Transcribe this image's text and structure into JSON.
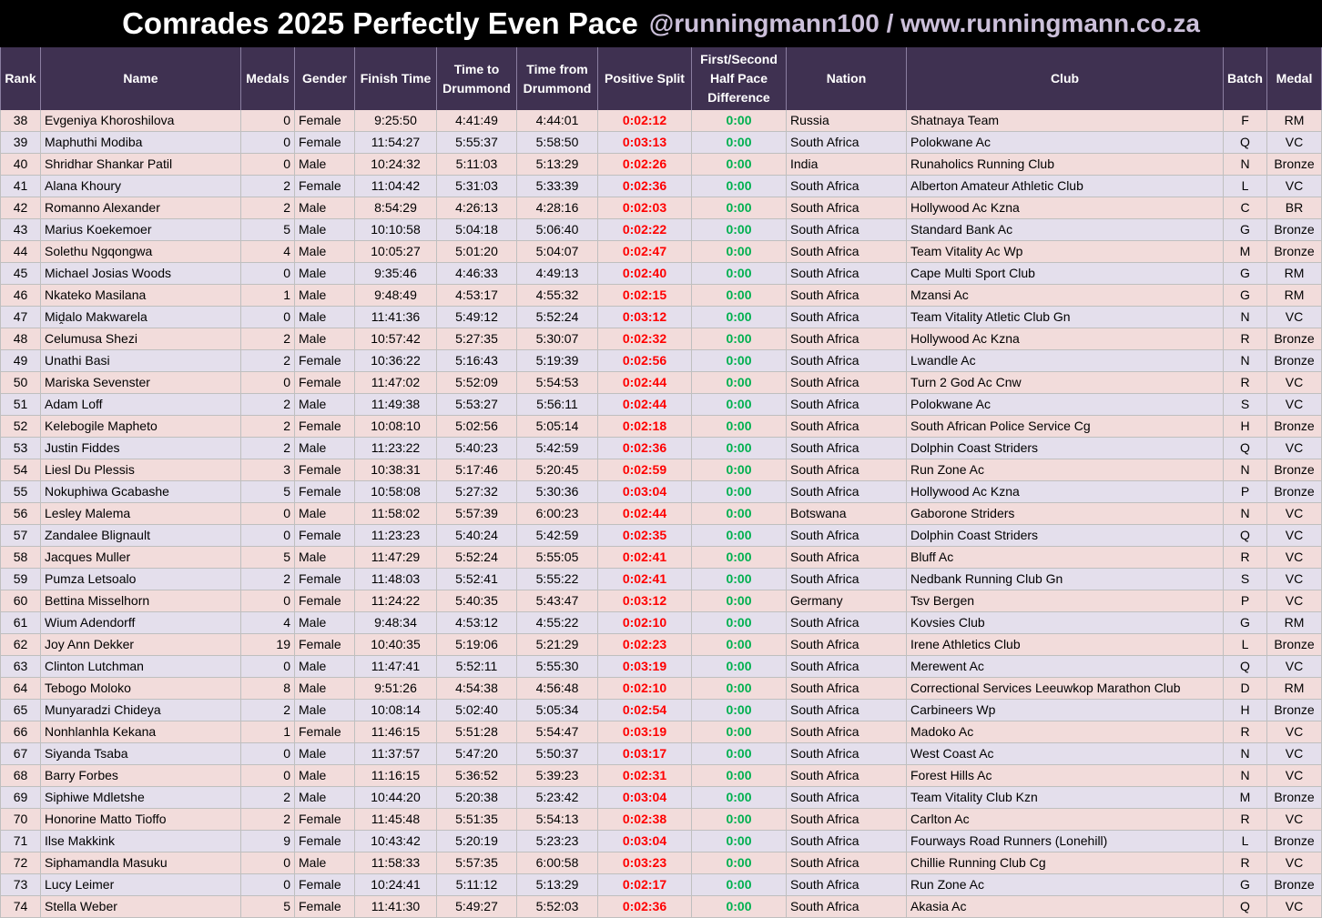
{
  "title": "Comrades 2025 Perfectly Even Pace",
  "subtitle": "@runningmann100 / www.runningmann.co.za",
  "colors": {
    "title_bar": "#000000",
    "subtitle": "#ccc0da",
    "header_bg": "#3f3151",
    "row_pink": "#f2dcdb",
    "row_lavender": "#e4dfec",
    "split_red": "#ff0000",
    "diff_green": "#00b050"
  },
  "columns": [
    "Rank",
    "Name",
    "Medals",
    "Gender",
    "Finish Time",
    "Time to\nDrummond",
    "Time from\nDrummond",
    "Positive Split",
    "First/Second\nHalf Pace\nDifference",
    "Nation",
    "Club",
    "Batch",
    "Medal"
  ],
  "rows": [
    [
      38,
      "Evgeniya Khoroshilova",
      0,
      "Female",
      "9:25:50",
      "4:41:49",
      "4:44:01",
      "0:02:12",
      "0:00",
      "Russia",
      "Shatnaya Team",
      "F",
      "RM"
    ],
    [
      39,
      "Maphuthi Modiba",
      0,
      "Female",
      "11:54:27",
      "5:55:37",
      "5:58:50",
      "0:03:13",
      "0:00",
      "South Africa",
      "Polokwane Ac",
      "Q",
      "VC"
    ],
    [
      40,
      "Shridhar Shankar Patil",
      0,
      "Male",
      "10:24:32",
      "5:11:03",
      "5:13:29",
      "0:02:26",
      "0:00",
      "India",
      "Runaholics Running Club",
      "N",
      "Bronze"
    ],
    [
      41,
      "Alana Khoury",
      2,
      "Female",
      "11:04:42",
      "5:31:03",
      "5:33:39",
      "0:02:36",
      "0:00",
      "South Africa",
      "Alberton Amateur Athletic Club",
      "L",
      "VC"
    ],
    [
      42,
      "Romanno Alexander",
      2,
      "Male",
      "8:54:29",
      "4:26:13",
      "4:28:16",
      "0:02:03",
      "0:00",
      "South Africa",
      "Hollywood Ac Kzna",
      "C",
      "BR"
    ],
    [
      43,
      "Marius Koekemoer",
      5,
      "Male",
      "10:10:58",
      "5:04:18",
      "5:06:40",
      "0:02:22",
      "0:00",
      "South Africa",
      "Standard Bank Ac",
      "G",
      "Bronze"
    ],
    [
      44,
      "Solethu Ngqongwa",
      4,
      "Male",
      "10:05:27",
      "5:01:20",
      "5:04:07",
      "0:02:47",
      "0:00",
      "South Africa",
      "Team Vitality Ac Wp",
      "M",
      "Bronze"
    ],
    [
      45,
      "Michael Josias Woods",
      0,
      "Male",
      "9:35:46",
      "4:46:33",
      "4:49:13",
      "0:02:40",
      "0:00",
      "South Africa",
      "Cape Multi Sport Club",
      "G",
      "RM"
    ],
    [
      46,
      "Nkateko Masilana",
      1,
      "Male",
      "9:48:49",
      "4:53:17",
      "4:55:32",
      "0:02:15",
      "0:00",
      "South Africa",
      "Mzansi Ac",
      "G",
      "RM"
    ],
    [
      47,
      "Miḓalo Makwarela",
      0,
      "Male",
      "11:41:36",
      "5:49:12",
      "5:52:24",
      "0:03:12",
      "0:00",
      "South Africa",
      "Team Vitality Atletic Club Gn",
      "N",
      "VC"
    ],
    [
      48,
      "Celumusa Shezi",
      2,
      "Male",
      "10:57:42",
      "5:27:35",
      "5:30:07",
      "0:02:32",
      "0:00",
      "South Africa",
      "Hollywood Ac Kzna",
      "R",
      "Bronze"
    ],
    [
      49,
      "Unathi Basi",
      2,
      "Female",
      "10:36:22",
      "5:16:43",
      "5:19:39",
      "0:02:56",
      "0:00",
      "South Africa",
      "Lwandle Ac",
      "N",
      "Bronze"
    ],
    [
      50,
      "Mariska Sevenster",
      0,
      "Female",
      "11:47:02",
      "5:52:09",
      "5:54:53",
      "0:02:44",
      "0:00",
      "South Africa",
      "Turn 2 God Ac Cnw",
      "R",
      "VC"
    ],
    [
      51,
      "Adam Loff",
      2,
      "Male",
      "11:49:38",
      "5:53:27",
      "5:56:11",
      "0:02:44",
      "0:00",
      "South Africa",
      "Polokwane Ac",
      "S",
      "VC"
    ],
    [
      52,
      "Kelebogile Mapheto",
      2,
      "Female",
      "10:08:10",
      "5:02:56",
      "5:05:14",
      "0:02:18",
      "0:00",
      "South Africa",
      "South African Police Service Cg",
      "H",
      "Bronze"
    ],
    [
      53,
      "Justin Fiddes",
      2,
      "Male",
      "11:23:22",
      "5:40:23",
      "5:42:59",
      "0:02:36",
      "0:00",
      "South Africa",
      "Dolphin Coast Striders",
      "Q",
      "VC"
    ],
    [
      54,
      "Liesl Du Plessis",
      3,
      "Female",
      "10:38:31",
      "5:17:46",
      "5:20:45",
      "0:02:59",
      "0:00",
      "South Africa",
      "Run Zone Ac",
      "N",
      "Bronze"
    ],
    [
      55,
      "Nokuphiwa Gcabashe",
      5,
      "Female",
      "10:58:08",
      "5:27:32",
      "5:30:36",
      "0:03:04",
      "0:00",
      "South Africa",
      "Hollywood Ac Kzna",
      "P",
      "Bronze"
    ],
    [
      56,
      "Lesley Malema",
      0,
      "Male",
      "11:58:02",
      "5:57:39",
      "6:00:23",
      "0:02:44",
      "0:00",
      "Botswana",
      "Gaborone Striders",
      "N",
      "VC"
    ],
    [
      57,
      "Zandalee Blignault",
      0,
      "Female",
      "11:23:23",
      "5:40:24",
      "5:42:59",
      "0:02:35",
      "0:00",
      "South Africa",
      "Dolphin Coast Striders",
      "Q",
      "VC"
    ],
    [
      58,
      "Jacques Muller",
      5,
      "Male",
      "11:47:29",
      "5:52:24",
      "5:55:05",
      "0:02:41",
      "0:00",
      "South Africa",
      "Bluff Ac",
      "R",
      "VC"
    ],
    [
      59,
      "Pumza Letsoalo",
      2,
      "Female",
      "11:48:03",
      "5:52:41",
      "5:55:22",
      "0:02:41",
      "0:00",
      "South Africa",
      "Nedbank Running Club Gn",
      "S",
      "VC"
    ],
    [
      60,
      "Bettina Misselhorn",
      0,
      "Female",
      "11:24:22",
      "5:40:35",
      "5:43:47",
      "0:03:12",
      "0:00",
      "Germany",
      "Tsv Bergen",
      "P",
      "VC"
    ],
    [
      61,
      "Wium Adendorff",
      4,
      "Male",
      "9:48:34",
      "4:53:12",
      "4:55:22",
      "0:02:10",
      "0:00",
      "South Africa",
      "Kovsies Club",
      "G",
      "RM"
    ],
    [
      62,
      "Joy Ann Dekker",
      19,
      "Female",
      "10:40:35",
      "5:19:06",
      "5:21:29",
      "0:02:23",
      "0:00",
      "South Africa",
      "Irene Athletics Club",
      "L",
      "Bronze"
    ],
    [
      63,
      "Clinton Lutchman",
      0,
      "Male",
      "11:47:41",
      "5:52:11",
      "5:55:30",
      "0:03:19",
      "0:00",
      "South Africa",
      "Merewent Ac",
      "Q",
      "VC"
    ],
    [
      64,
      "Tebogo Moloko",
      8,
      "Male",
      "9:51:26",
      "4:54:38",
      "4:56:48",
      "0:02:10",
      "0:00",
      "South Africa",
      "Correctional Services Leeuwkop Marathon Club",
      "D",
      "RM"
    ],
    [
      65,
      "Munyaradzi Chideya",
      2,
      "Male",
      "10:08:14",
      "5:02:40",
      "5:05:34",
      "0:02:54",
      "0:00",
      "South Africa",
      "Carbineers Wp",
      "H",
      "Bronze"
    ],
    [
      66,
      "Nonhlanhla Kekana",
      1,
      "Female",
      "11:46:15",
      "5:51:28",
      "5:54:47",
      "0:03:19",
      "0:00",
      "South Africa",
      "Madoko Ac",
      "R",
      "VC"
    ],
    [
      67,
      "Siyanda Tsaba",
      0,
      "Male",
      "11:37:57",
      "5:47:20",
      "5:50:37",
      "0:03:17",
      "0:00",
      "South Africa",
      "West Coast Ac",
      "N",
      "VC"
    ],
    [
      68,
      "Barry Forbes",
      0,
      "Male",
      "11:16:15",
      "5:36:52",
      "5:39:23",
      "0:02:31",
      "0:00",
      "South Africa",
      "Forest Hills Ac",
      "N",
      "VC"
    ],
    [
      69,
      "Siphiwe Mdletshe",
      2,
      "Male",
      "10:44:20",
      "5:20:38",
      "5:23:42",
      "0:03:04",
      "0:00",
      "South Africa",
      "Team Vitality Club Kzn",
      "M",
      "Bronze"
    ],
    [
      70,
      "Honorine Matto Tioffo",
      2,
      "Female",
      "11:45:48",
      "5:51:35",
      "5:54:13",
      "0:02:38",
      "0:00",
      "South Africa",
      "Carlton Ac",
      "R",
      "VC"
    ],
    [
      71,
      "Ilse Makkink",
      9,
      "Female",
      "10:43:42",
      "5:20:19",
      "5:23:23",
      "0:03:04",
      "0:00",
      "South Africa",
      "Fourways Road Runners (Lonehill)",
      "L",
      "Bronze"
    ],
    [
      72,
      "Siphamandla Masuku",
      0,
      "Male",
      "11:58:33",
      "5:57:35",
      "6:00:58",
      "0:03:23",
      "0:00",
      "South Africa",
      "Chillie Running Club Cg",
      "R",
      "VC"
    ],
    [
      73,
      "Lucy Leimer",
      0,
      "Female",
      "10:24:41",
      "5:11:12",
      "5:13:29",
      "0:02:17",
      "0:00",
      "South Africa",
      "Run Zone Ac",
      "G",
      "Bronze"
    ],
    [
      74,
      "Stella Weber",
      5,
      "Female",
      "11:41:30",
      "5:49:27",
      "5:52:03",
      "0:02:36",
      "0:00",
      "South Africa",
      "Akasia Ac",
      "Q",
      "VC"
    ]
  ]
}
